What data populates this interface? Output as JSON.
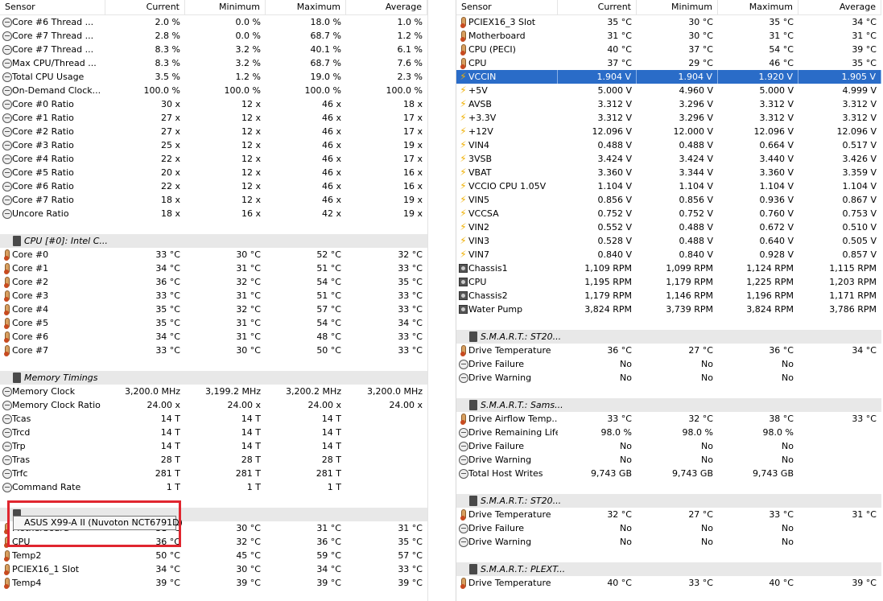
{
  "columns": {
    "sensor": "Sensor",
    "current": "Current",
    "minimum": "Minimum",
    "maximum": "Maximum",
    "average": "Average"
  },
  "left": [
    {
      "icon": "clock",
      "name": "Core #6 Thread ...",
      "cur": "2.0 %",
      "min": "0.0 %",
      "max": "18.0 %",
      "avg": "1.0 %"
    },
    {
      "icon": "clock",
      "name": "Core #7 Thread ...",
      "cur": "2.8 %",
      "min": "0.0 %",
      "max": "68.7 %",
      "avg": "1.2 %"
    },
    {
      "icon": "clock",
      "name": "Core #7 Thread ...",
      "cur": "8.3 %",
      "min": "3.2 %",
      "max": "40.1 %",
      "avg": "6.1 %"
    },
    {
      "icon": "clock",
      "name": "Max CPU/Thread ...",
      "cur": "8.3 %",
      "min": "3.2 %",
      "max": "68.7 %",
      "avg": "7.6 %"
    },
    {
      "icon": "clock",
      "name": "Total CPU Usage",
      "cur": "3.5 %",
      "min": "1.2 %",
      "max": "19.0 %",
      "avg": "2.3 %"
    },
    {
      "icon": "clock",
      "name": "On-Demand Clock...",
      "cur": "100.0 %",
      "min": "100.0 %",
      "max": "100.0 %",
      "avg": "100.0 %"
    },
    {
      "icon": "clock",
      "name": "Core #0 Ratio",
      "cur": "30 x",
      "min": "12 x",
      "max": "46 x",
      "avg": "18 x"
    },
    {
      "icon": "clock",
      "name": "Core #1 Ratio",
      "cur": "27 x",
      "min": "12 x",
      "max": "46 x",
      "avg": "17 x"
    },
    {
      "icon": "clock",
      "name": "Core #2 Ratio",
      "cur": "27 x",
      "min": "12 x",
      "max": "46 x",
      "avg": "17 x"
    },
    {
      "icon": "clock",
      "name": "Core #3 Ratio",
      "cur": "25 x",
      "min": "12 x",
      "max": "46 x",
      "avg": "19 x"
    },
    {
      "icon": "clock",
      "name": "Core #4 Ratio",
      "cur": "22 x",
      "min": "12 x",
      "max": "46 x",
      "avg": "17 x"
    },
    {
      "icon": "clock",
      "name": "Core #5 Ratio",
      "cur": "20 x",
      "min": "12 x",
      "max": "46 x",
      "avg": "16 x"
    },
    {
      "icon": "clock",
      "name": "Core #6 Ratio",
      "cur": "22 x",
      "min": "12 x",
      "max": "46 x",
      "avg": "16 x"
    },
    {
      "icon": "clock",
      "name": "Core #7 Ratio",
      "cur": "18 x",
      "min": "12 x",
      "max": "46 x",
      "avg": "19 x"
    },
    {
      "icon": "clock",
      "name": "Uncore Ratio",
      "cur": "18 x",
      "min": "16 x",
      "max": "42 x",
      "avg": "19 x"
    },
    {
      "type": "spacer"
    },
    {
      "type": "group",
      "name": "CPU [#0]: Intel C..."
    },
    {
      "icon": "thermo",
      "name": "Core #0",
      "cur": "33 °C",
      "min": "30 °C",
      "max": "52 °C",
      "avg": "32 °C"
    },
    {
      "icon": "thermo",
      "name": "Core #1",
      "cur": "34 °C",
      "min": "31 °C",
      "max": "51 °C",
      "avg": "33 °C"
    },
    {
      "icon": "thermo",
      "name": "Core #2",
      "cur": "36 °C",
      "min": "32 °C",
      "max": "54 °C",
      "avg": "35 °C"
    },
    {
      "icon": "thermo",
      "name": "Core #3",
      "cur": "33 °C",
      "min": "31 °C",
      "max": "51 °C",
      "avg": "33 °C"
    },
    {
      "icon": "thermo",
      "name": "Core #4",
      "cur": "35 °C",
      "min": "32 °C",
      "max": "57 °C",
      "avg": "33 °C"
    },
    {
      "icon": "thermo",
      "name": "Core #5",
      "cur": "35 °C",
      "min": "31 °C",
      "max": "54 °C",
      "avg": "34 °C"
    },
    {
      "icon": "thermo",
      "name": "Core #6",
      "cur": "34 °C",
      "min": "31 °C",
      "max": "48 °C",
      "avg": "33 °C"
    },
    {
      "icon": "thermo",
      "name": "Core #7",
      "cur": "33 °C",
      "min": "30 °C",
      "max": "50 °C",
      "avg": "33 °C"
    },
    {
      "type": "spacer"
    },
    {
      "type": "group",
      "name": "Memory Timings"
    },
    {
      "icon": "clock",
      "name": "Memory Clock",
      "cur": "3,200.0 MHz",
      "min": "3,199.2 MHz",
      "max": "3,200.2 MHz",
      "avg": "3,200.0 MHz"
    },
    {
      "icon": "clock",
      "name": "Memory Clock Ratio",
      "cur": "24.00 x",
      "min": "24.00 x",
      "max": "24.00 x",
      "avg": "24.00 x"
    },
    {
      "icon": "clock",
      "name": "Tcas",
      "cur": "14 T",
      "min": "14 T",
      "max": "14 T",
      "avg": ""
    },
    {
      "icon": "clock",
      "name": "Trcd",
      "cur": "14 T",
      "min": "14 T",
      "max": "14 T",
      "avg": ""
    },
    {
      "icon": "clock",
      "name": "Trp",
      "cur": "14 T",
      "min": "14 T",
      "max": "14 T",
      "avg": ""
    },
    {
      "icon": "clock",
      "name": "Tras",
      "cur": "28 T",
      "min": "28 T",
      "max": "28 T",
      "avg": ""
    },
    {
      "icon": "clock",
      "name": "Trfc",
      "cur": "281 T",
      "min": "281 T",
      "max": "281 T",
      "avg": ""
    },
    {
      "icon": "clock",
      "name": "Command Rate",
      "cur": "1 T",
      "min": "1 T",
      "max": "1 T",
      "avg": ""
    },
    {
      "type": "spacer"
    },
    {
      "type": "group",
      "name": ""
    },
    {
      "icon": "thermo",
      "name": "Motherboard",
      "cur": "31 °C",
      "min": "30 °C",
      "max": "31 °C",
      "avg": "31 °C"
    },
    {
      "icon": "thermo",
      "name": "CPU",
      "cur": "36 °C",
      "min": "32 °C",
      "max": "36 °C",
      "avg": "35 °C"
    },
    {
      "icon": "thermo",
      "name": "Temp2",
      "cur": "50 °C",
      "min": "45 °C",
      "max": "59 °C",
      "avg": "57 °C"
    },
    {
      "icon": "thermo",
      "name": "PCIEX16_1 Slot",
      "cur": "34 °C",
      "min": "30 °C",
      "max": "34 °C",
      "avg": "33 °C"
    },
    {
      "icon": "thermo",
      "name": "Temp4",
      "cur": "39 °C",
      "min": "39 °C",
      "max": "39 °C",
      "avg": "39 °C"
    }
  ],
  "right": [
    {
      "icon": "thermo",
      "name": "PCIEX16_3 Slot",
      "cur": "35 °C",
      "min": "30 °C",
      "max": "35 °C",
      "avg": "34 °C"
    },
    {
      "icon": "thermo",
      "name": "Motherboard",
      "cur": "31 °C",
      "min": "30 °C",
      "max": "31 °C",
      "avg": "31 °C"
    },
    {
      "icon": "thermo",
      "name": "CPU (PECI)",
      "cur": "40 °C",
      "min": "37 °C",
      "max": "54 °C",
      "avg": "39 °C"
    },
    {
      "icon": "thermo",
      "name": "CPU",
      "cur": "37 °C",
      "min": "29 °C",
      "max": "46 °C",
      "avg": "35 °C"
    },
    {
      "icon": "bolt",
      "name": "VCCIN",
      "cur": "1.904 V",
      "min": "1.904 V",
      "max": "1.920 V",
      "avg": "1.905 V",
      "selected": true
    },
    {
      "icon": "bolt",
      "name": "+5V",
      "cur": "5.000 V",
      "min": "4.960 V",
      "max": "5.000 V",
      "avg": "4.999 V"
    },
    {
      "icon": "bolt",
      "name": "AVSB",
      "cur": "3.312 V",
      "min": "3.296 V",
      "max": "3.312 V",
      "avg": "3.312 V"
    },
    {
      "icon": "bolt",
      "name": "+3.3V",
      "cur": "3.312 V",
      "min": "3.296 V",
      "max": "3.312 V",
      "avg": "3.312 V"
    },
    {
      "icon": "bolt",
      "name": "+12V",
      "cur": "12.096 V",
      "min": "12.000 V",
      "max": "12.096 V",
      "avg": "12.096 V"
    },
    {
      "icon": "bolt",
      "name": "VIN4",
      "cur": "0.488 V",
      "min": "0.488 V",
      "max": "0.664 V",
      "avg": "0.517 V"
    },
    {
      "icon": "bolt",
      "name": "3VSB",
      "cur": "3.424 V",
      "min": "3.424 V",
      "max": "3.440 V",
      "avg": "3.426 V"
    },
    {
      "icon": "bolt",
      "name": "VBAT",
      "cur": "3.360 V",
      "min": "3.344 V",
      "max": "3.360 V",
      "avg": "3.359 V"
    },
    {
      "icon": "bolt",
      "name": "VCCIO CPU 1.05V",
      "cur": "1.104 V",
      "min": "1.104 V",
      "max": "1.104 V",
      "avg": "1.104 V"
    },
    {
      "icon": "bolt",
      "name": "VIN5",
      "cur": "0.856 V",
      "min": "0.856 V",
      "max": "0.936 V",
      "avg": "0.867 V"
    },
    {
      "icon": "bolt",
      "name": "VCCSA",
      "cur": "0.752 V",
      "min": "0.752 V",
      "max": "0.760 V",
      "avg": "0.753 V"
    },
    {
      "icon": "bolt",
      "name": "VIN2",
      "cur": "0.552 V",
      "min": "0.488 V",
      "max": "0.672 V",
      "avg": "0.510 V"
    },
    {
      "icon": "bolt",
      "name": "VIN3",
      "cur": "0.528 V",
      "min": "0.488 V",
      "max": "0.640 V",
      "avg": "0.505 V"
    },
    {
      "icon": "bolt",
      "name": "VIN7",
      "cur": "0.840 V",
      "min": "0.840 V",
      "max": "0.928 V",
      "avg": "0.857 V"
    },
    {
      "icon": "fan",
      "name": "Chassis1",
      "cur": "1,109 RPM",
      "min": "1,099 RPM",
      "max": "1,124 RPM",
      "avg": "1,115 RPM"
    },
    {
      "icon": "fan",
      "name": "CPU",
      "cur": "1,195 RPM",
      "min": "1,179 RPM",
      "max": "1,225 RPM",
      "avg": "1,203 RPM"
    },
    {
      "icon": "fan",
      "name": "Chassis2",
      "cur": "1,179 RPM",
      "min": "1,146 RPM",
      "max": "1,196 RPM",
      "avg": "1,171 RPM"
    },
    {
      "icon": "fan",
      "name": "Water Pump",
      "cur": "3,824 RPM",
      "min": "3,739 RPM",
      "max": "3,824 RPM",
      "avg": "3,786 RPM"
    },
    {
      "type": "spacer"
    },
    {
      "type": "group",
      "name": "S.M.A.R.T.: ST20..."
    },
    {
      "icon": "thermo",
      "name": "Drive Temperature",
      "cur": "36 °C",
      "min": "27 °C",
      "max": "36 °C",
      "avg": "34 °C"
    },
    {
      "icon": "clock",
      "name": "Drive Failure",
      "cur": "No",
      "min": "No",
      "max": "No",
      "avg": ""
    },
    {
      "icon": "clock",
      "name": "Drive Warning",
      "cur": "No",
      "min": "No",
      "max": "No",
      "avg": ""
    },
    {
      "type": "spacer"
    },
    {
      "type": "group",
      "name": "S.M.A.R.T.: Sams..."
    },
    {
      "icon": "thermo",
      "name": "Drive Airflow Temp...",
      "cur": "33 °C",
      "min": "32 °C",
      "max": "38 °C",
      "avg": "33 °C"
    },
    {
      "icon": "clock",
      "name": "Drive Remaining Life",
      "cur": "98.0 %",
      "min": "98.0 %",
      "max": "98.0 %",
      "avg": ""
    },
    {
      "icon": "clock",
      "name": "Drive Failure",
      "cur": "No",
      "min": "No",
      "max": "No",
      "avg": ""
    },
    {
      "icon": "clock",
      "name": "Drive Warning",
      "cur": "No",
      "min": "No",
      "max": "No",
      "avg": ""
    },
    {
      "icon": "clock",
      "name": "Total Host Writes",
      "cur": "9,743 GB",
      "min": "9,743 GB",
      "max": "9,743 GB",
      "avg": ""
    },
    {
      "type": "spacer"
    },
    {
      "type": "group",
      "name": "S.M.A.R.T.: ST20..."
    },
    {
      "icon": "thermo",
      "name": "Drive Temperature",
      "cur": "32 °C",
      "min": "27 °C",
      "max": "33 °C",
      "avg": "31 °C"
    },
    {
      "icon": "clock",
      "name": "Drive Failure",
      "cur": "No",
      "min": "No",
      "max": "No",
      "avg": ""
    },
    {
      "icon": "clock",
      "name": "Drive Warning",
      "cur": "No",
      "min": "No",
      "max": "No",
      "avg": ""
    },
    {
      "type": "spacer"
    },
    {
      "type": "group",
      "name": "S.M.A.R.T.: PLEXT..."
    },
    {
      "icon": "thermo",
      "name": "Drive Temperature",
      "cur": "40 °C",
      "min": "33 °C",
      "max": "40 °C",
      "avg": "39 °C"
    }
  ],
  "tooltip": {
    "text": "ASUS X99-A II (Nuvoton NCT6791D)"
  }
}
